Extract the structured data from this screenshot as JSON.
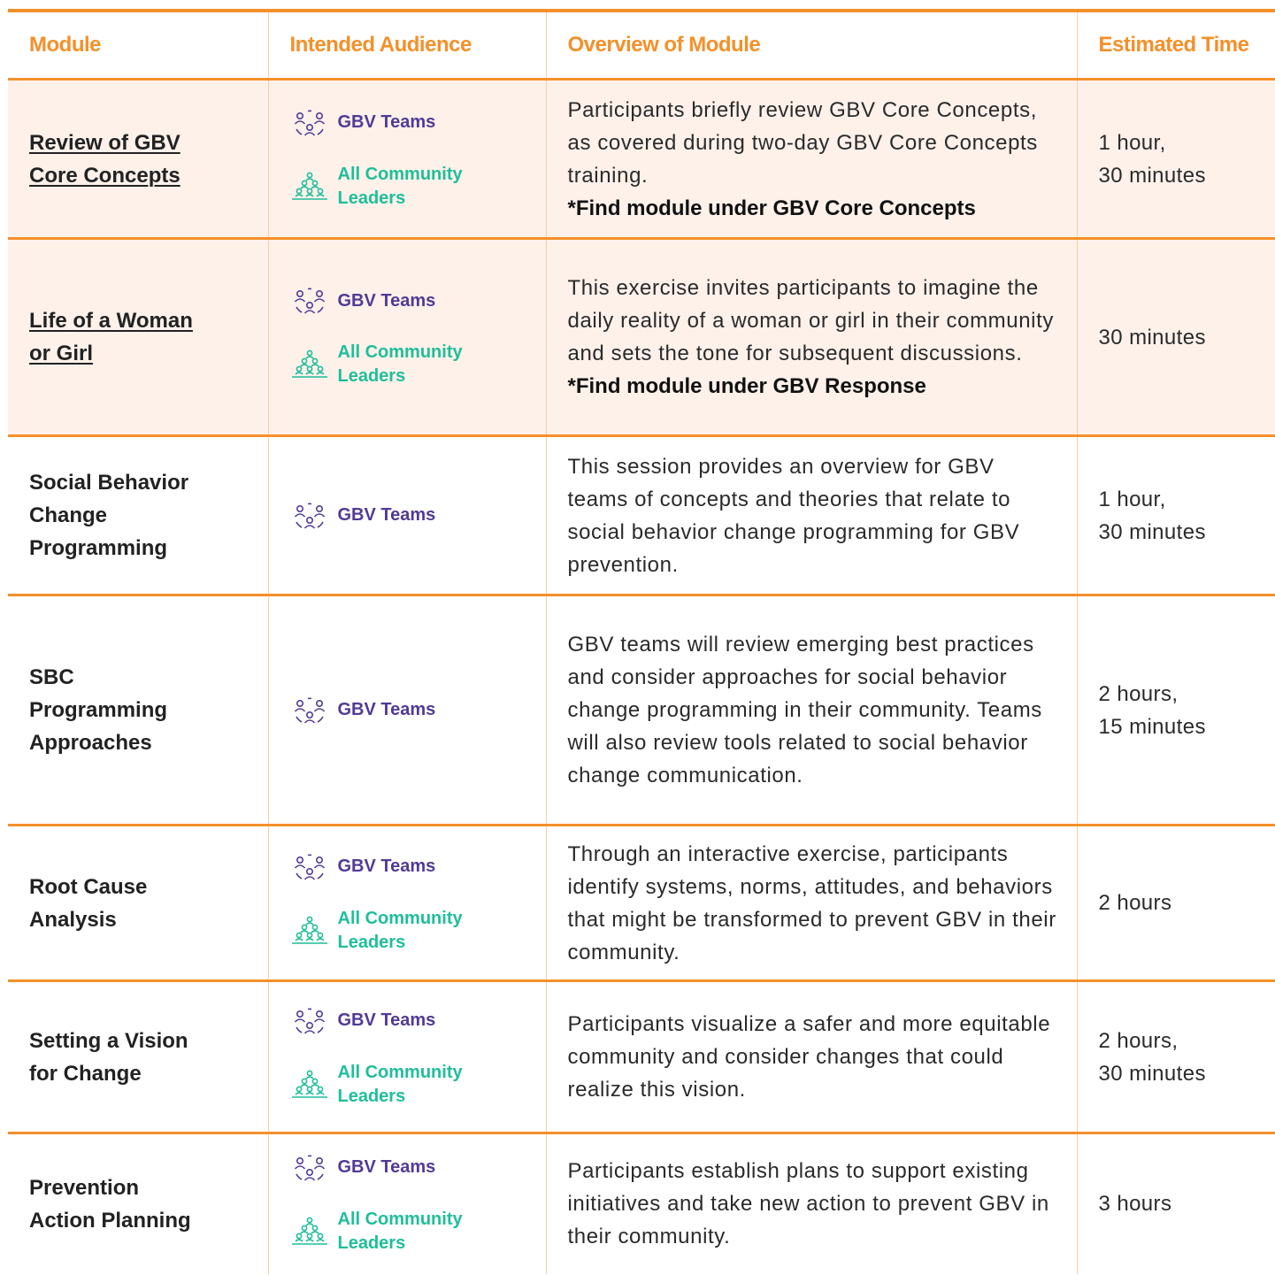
{
  "headers": {
    "module": "Module",
    "audience": "Intended Audience",
    "overview": "Overview of Module",
    "time": "Estimated Time"
  },
  "audience_labels": {
    "gbv_teams": "GBV Teams",
    "leaders": "All Community\nLeaders"
  },
  "colors": {
    "accent_orange": "#f4902a",
    "teams_purple": "#513a96",
    "leaders_green": "#1fbe9a",
    "row_shade": "#fdf1ea"
  },
  "icons": {
    "gbv_teams": "people-circle-icon",
    "leaders": "people-pyramid-icon"
  },
  "rows": [
    {
      "module": "Review of GBV\nCore Concepts",
      "link": true,
      "shaded": true,
      "audience": [
        "gbv_teams",
        "leaders"
      ],
      "overview": "Participants briefly review GBV Core Concepts, as covered during two-day GBV Core Concepts training.",
      "note": "*Find module under GBV Core Concepts",
      "time": "1 hour,\n30 minutes"
    },
    {
      "module": "Life of a Woman\nor Girl",
      "link": true,
      "shaded": true,
      "audience": [
        "gbv_teams",
        "leaders"
      ],
      "overview": "This exercise invites participants to imagine the daily reality of a woman or girl in their community and sets the tone for subsequent discussions.",
      "note": "*Find module under GBV Response",
      "time": "30 minutes"
    },
    {
      "module": "Social Behavior\nChange\nProgramming",
      "link": false,
      "shaded": false,
      "audience": [
        "gbv_teams"
      ],
      "overview": "This session provides an overview for GBV teams of concepts and theories that relate to social behavior change programming for GBV prevention.",
      "note": "",
      "time": "1 hour,\n30 minutes"
    },
    {
      "module": "SBC\nProgramming\nApproaches",
      "link": false,
      "shaded": false,
      "audience": [
        "gbv_teams"
      ],
      "overview": "GBV teams will review emerging best practices and consider approaches for social behavior change programming in their community. Teams will also review tools related to social behavior change communication.",
      "note": "",
      "time": "2 hours,\n15 minutes"
    },
    {
      "module": "Root Cause\nAnalysis",
      "link": false,
      "shaded": false,
      "audience": [
        "gbv_teams",
        "leaders"
      ],
      "overview": "Through an interactive exercise, participants identify systems, norms, attitudes, and behaviors that might be transformed to prevent GBV in their community.",
      "note": "",
      "time": "2 hours"
    },
    {
      "module": "Setting a Vision\nfor Change",
      "link": false,
      "shaded": false,
      "audience": [
        "gbv_teams",
        "leaders"
      ],
      "overview": "Participants visualize a safer and more equitable community and consider changes that could realize this vision.",
      "note": "",
      "time": "2 hours,\n30 minutes"
    },
    {
      "module": "Prevention\nAction Planning",
      "link": false,
      "shaded": false,
      "audience": [
        "gbv_teams",
        "leaders"
      ],
      "overview": "Participants establish plans to support existing initiatives and take new action to prevent GBV in their community.",
      "note": "",
      "time": "3 hours"
    }
  ]
}
